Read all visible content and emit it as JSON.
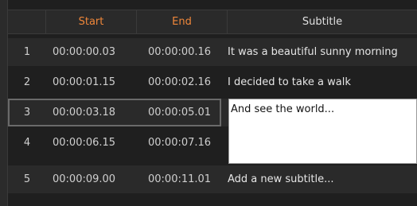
{
  "table": {
    "headers": {
      "number": "",
      "start": "Start",
      "end": "End",
      "subtitle": "Subtitle"
    },
    "rows": [
      {
        "number": "1",
        "start": "00:00:00.03",
        "end": "00:00:00.16",
        "subtitle": "It was a beautiful sunny morning"
      },
      {
        "number": "2",
        "start": "00:00:01.15",
        "end": "00:00:02.16",
        "subtitle": "I decided to take a walk"
      },
      {
        "number": "3",
        "start": "00:00:03.18",
        "end": "00:00:05.01",
        "subtitle": ""
      },
      {
        "number": "4",
        "start": "00:00:06.15",
        "end": "00:00:07.16",
        "subtitle": ""
      },
      {
        "number": "5",
        "start": "00:00:09.00",
        "end": "00:00:11.01",
        "subtitle": "Add a new subtitle..."
      }
    ]
  },
  "editor": {
    "value": "And see the world..."
  },
  "colors": {
    "header_accent": "#f0873a",
    "editor_bg": "#ffffff"
  }
}
